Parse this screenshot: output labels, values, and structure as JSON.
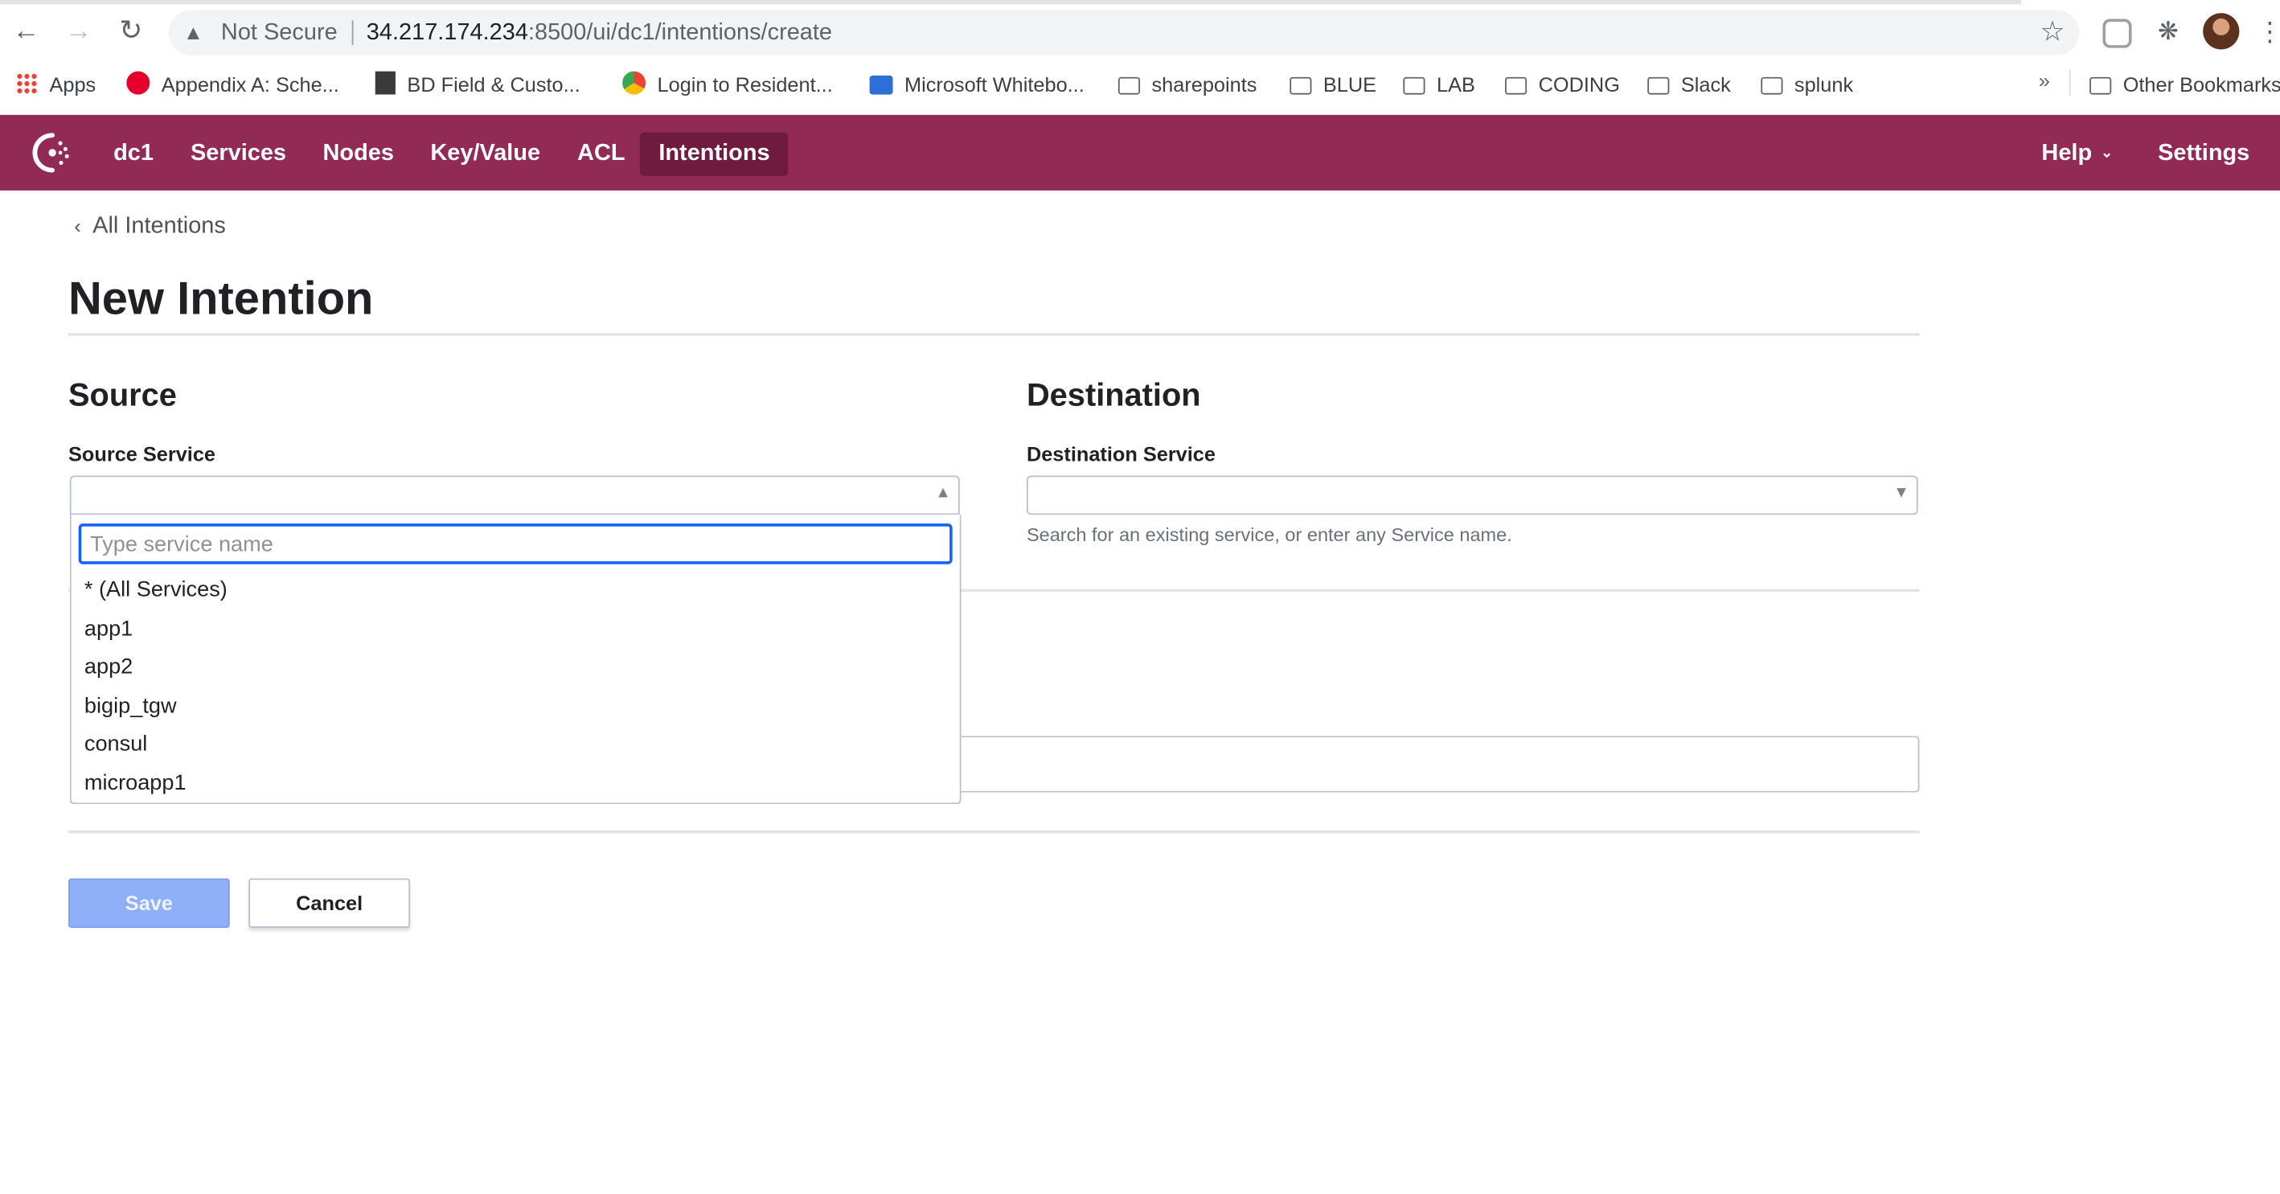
{
  "browser": {
    "security_label": "Not Secure",
    "url_host": "34.217.174.234",
    "url_path": ":8500/ui/dc1/intentions/create",
    "icons": [
      "back-arrow-icon",
      "forward-arrow-icon",
      "reload-icon",
      "warning-icon",
      "star-icon",
      "puzzle-icon",
      "kebab-icon"
    ]
  },
  "bookmarks": {
    "items": [
      {
        "label": "Apps",
        "icon": "apps-grid-icon"
      },
      {
        "label": "Appendix A: Sche...",
        "icon": "f5-icon"
      },
      {
        "label": "BD Field & Custo...",
        "icon": "check-icon"
      },
      {
        "label": "Login to Resident...",
        "icon": "chrome-icon"
      },
      {
        "label": "Microsoft Whitebo...",
        "icon": "whiteboard-icon"
      },
      {
        "label": "sharepoints",
        "icon": "folder-icon"
      },
      {
        "label": "BLUE",
        "icon": "folder-icon"
      },
      {
        "label": "LAB",
        "icon": "folder-icon"
      },
      {
        "label": "CODING",
        "icon": "folder-icon"
      },
      {
        "label": "Slack",
        "icon": "folder-icon"
      },
      {
        "label": "splunk",
        "icon": "folder-icon"
      }
    ],
    "overflow": "»",
    "other": "Other Bookmarks"
  },
  "header": {
    "datacenter": "dc1",
    "nav": [
      "Services",
      "Nodes",
      "Key/Value",
      "ACL",
      "Intentions"
    ],
    "active": "Intentions",
    "help": "Help",
    "settings": "Settings",
    "brand_color": "#912b55"
  },
  "page": {
    "breadcrumb": "All Intentions",
    "title": "New Intention"
  },
  "source": {
    "heading": "Source",
    "label": "Source Service",
    "search_placeholder": "Type service name",
    "options": [
      "* (All Services)",
      "app1",
      "app2",
      "bigip_tgw",
      "consul",
      "microapp1"
    ]
  },
  "destination": {
    "heading": "Destination",
    "label": "Destination Service",
    "help": "Search for an existing service, or enter any Service name."
  },
  "actions": {
    "save": "Save",
    "cancel": "Cancel"
  }
}
